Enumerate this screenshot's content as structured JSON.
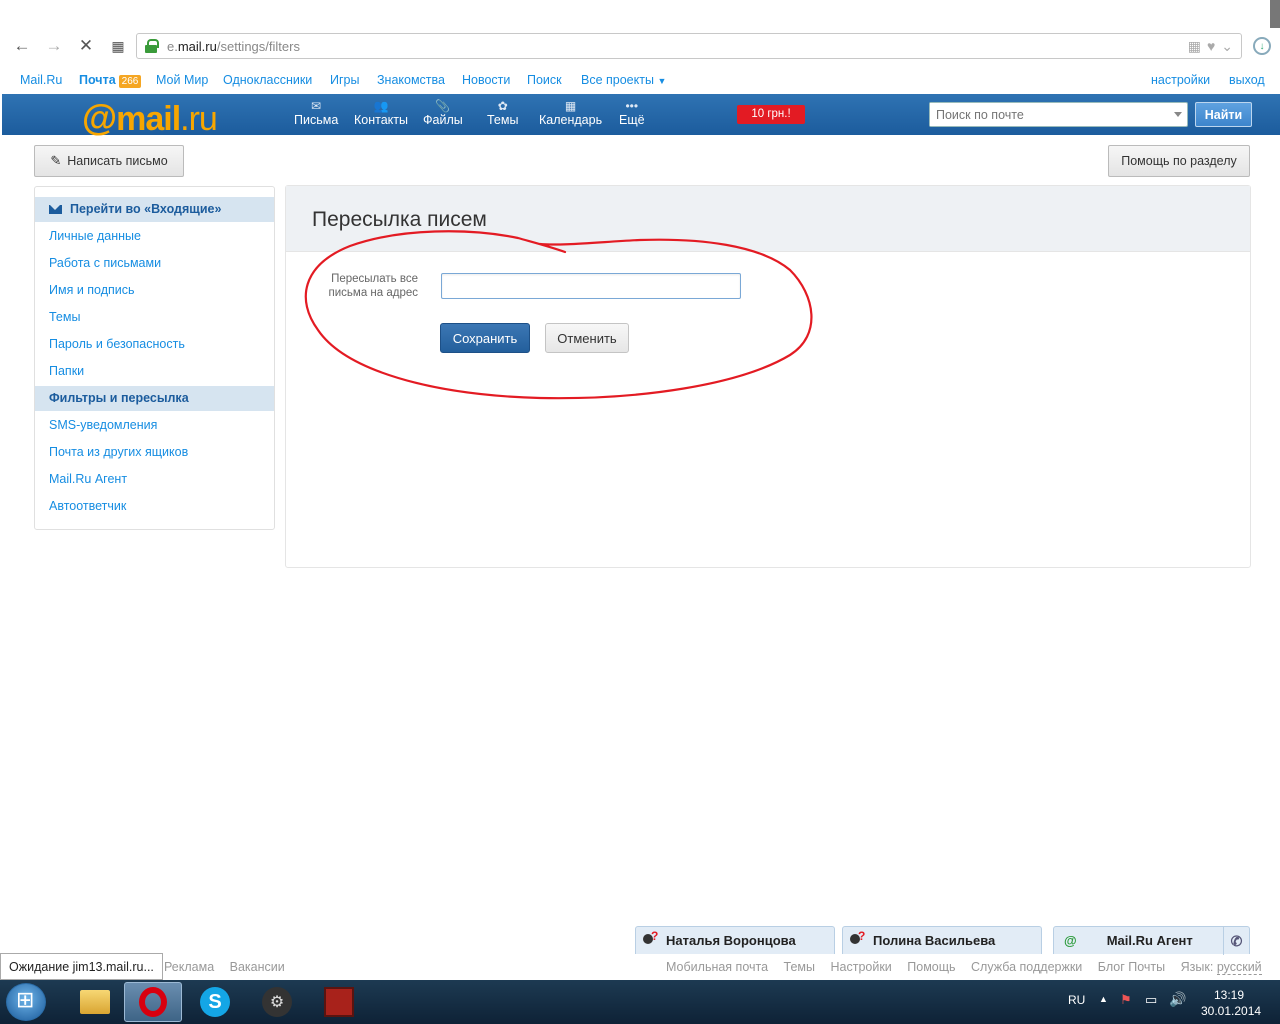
{
  "browser": {
    "url_prefix": "e.",
    "url_host": "mail.ru",
    "url_path": "/settings/filters"
  },
  "portal_menu": {
    "items": [
      "Mail.Ru",
      "Почта",
      "Мой Мир",
      "Одноклассники",
      "Игры",
      "Знакомства",
      "Новости",
      "Поиск",
      "Все проекты"
    ],
    "mail_count": "266",
    "settings": "настройки",
    "logout": "выход"
  },
  "header": {
    "logo_at": "@",
    "logo_mail": "mail",
    "logo_ru": ".ru",
    "nav": [
      "Письма",
      "Контакты",
      "Файлы",
      "Темы",
      "Календарь",
      "Ещё"
    ],
    "promo": "10 грн.!",
    "search_placeholder": "Поиск по почте",
    "find_button": "Найти"
  },
  "toolbar": {
    "compose": "Написать письмо",
    "help": "Помощь по разделу"
  },
  "sidebar": {
    "inbox": "Перейти во «Входящие»",
    "items": [
      "Личные данные",
      "Работа с письмами",
      "Имя и подпись",
      "Темы",
      "Пароль и безопасность",
      "Папки",
      "Фильтры и пересылка",
      "SMS-уведомления",
      "Почта из других ящиков",
      "Mail.Ru Агент",
      "Автоответчик"
    ],
    "active_index": 6
  },
  "main": {
    "title": "Пересылка писем",
    "field_label": "Пересылать все письма на адрес",
    "field_value": "",
    "save": "Сохранить",
    "cancel": "Отменить"
  },
  "agent": {
    "contacts": [
      "Наталья Воронцова",
      "Полина Васильева"
    ],
    "agent_tab": "Mail.Ru Агент"
  },
  "footer": {
    "left": [
      "Реклама",
      "Вакансии"
    ],
    "right": [
      "Мобильная почта",
      "Темы",
      "Настройки",
      "Помощь",
      "Служба поддержки",
      "Блог Почты"
    ],
    "lang_label": "Язык:",
    "lang_value": "русский"
  },
  "status_text": "Ожидание jim13.mail.ru...",
  "taskbar": {
    "lang": "RU",
    "time": "13:19",
    "date": "30.01.2014"
  },
  "colors": {
    "link": "#168de2",
    "header_blue": "#1c5c9d",
    "logo_orange": "#f7a600",
    "annotation_red": "#e31b23"
  }
}
